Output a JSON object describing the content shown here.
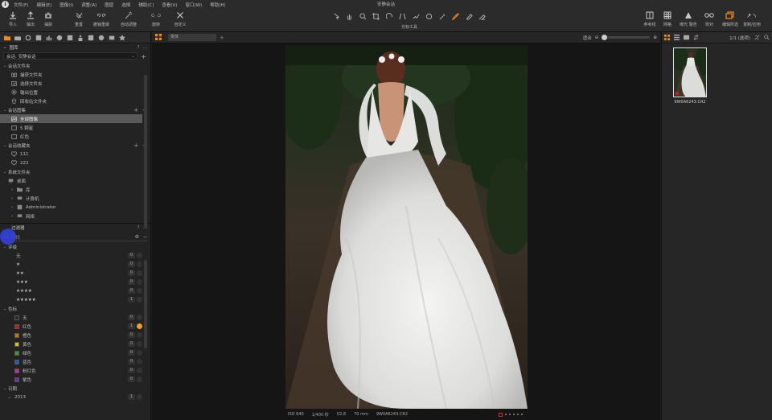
{
  "window": {
    "title": "安静会话",
    "menu": [
      "文件(F)",
      "编辑(E)",
      "图像(I)",
      "调整(A)",
      "图层",
      "选择",
      "辅助(C)",
      "查看(V)",
      "窗口(W)",
      "帮助(H)"
    ]
  },
  "toolbar": {
    "left": [
      {
        "label": "导入",
        "icon": "import-icon"
      },
      {
        "label": "输出",
        "icon": "export-icon"
      },
      {
        "label": "抽获",
        "icon": "camera-icon"
      },
      {
        "label": "重置",
        "icon": "reset-icon"
      },
      {
        "label": "撤销重做",
        "icon": "undo-icon"
      },
      {
        "label": "自动调整",
        "icon": "auto-adjust-icon"
      },
      {
        "label": "旋转",
        "icon": "rotate-icon"
      },
      {
        "label": "自定义",
        "icon": "customize-icon"
      }
    ],
    "cursor_tools_label": "光标工具",
    "right": [
      {
        "label": "参考线",
        "icon": "guides-icon"
      },
      {
        "label": "网格",
        "icon": "grid-icon"
      },
      {
        "label": "曝光 警告",
        "icon": "exposure-warning-icon"
      },
      {
        "label": "校对",
        "icon": "proof-icon"
      },
      {
        "label": "编辑所选",
        "icon": "edit-selected-icon"
      },
      {
        "label": "复制/应用",
        "icon": "copy-apply-icon"
      }
    ]
  },
  "library": {
    "title": "图库",
    "session_select": "会话: 安静会话",
    "session_folders": {
      "title": "会话文件夹",
      "items": [
        "捕获文件夹",
        "选择文件夹",
        "输出位置",
        "回收站文件夹"
      ]
    },
    "session_albums": {
      "title": "会话图集",
      "items": [
        "全部图像",
        "5 颗星",
        "红色"
      ]
    },
    "session_favorites": {
      "title": "会话收藏夹",
      "items": [
        "111",
        "222"
      ]
    },
    "system_folders": {
      "title": "系统文件夹",
      "items": [
        "桌面",
        "库",
        "计算机",
        "Administrator",
        "网络"
      ]
    }
  },
  "filters": {
    "title": "过滤器",
    "search_placeholder": "查找",
    "rating": {
      "title": "评级",
      "rows": [
        {
          "label": "无",
          "count": "0"
        },
        {
          "label": "★",
          "count": "0"
        },
        {
          "label": "★★",
          "count": "0"
        },
        {
          "label": "★★★",
          "count": "0"
        },
        {
          "label": "★★★★",
          "count": "0"
        },
        {
          "label": "★★★★★",
          "count": "1"
        }
      ]
    },
    "color_tag": {
      "title": "色标",
      "rows": [
        {
          "label": "无",
          "count": "0",
          "color": "#2a2a2a"
        },
        {
          "label": "红色",
          "count": "1",
          "color": "#c02020"
        },
        {
          "label": "橙色",
          "count": "0",
          "color": "#d07010"
        },
        {
          "label": "黄色",
          "count": "0",
          "color": "#d0c020"
        },
        {
          "label": "绿色",
          "count": "0",
          "color": "#30a030"
        },
        {
          "label": "蓝色",
          "count": "0",
          "color": "#2060c0"
        },
        {
          "label": "粉红色",
          "count": "0",
          "color": "#c030a0"
        },
        {
          "label": "紫色",
          "count": "0",
          "color": "#7030b0"
        }
      ]
    },
    "date": {
      "title": "日期",
      "rows": [
        {
          "label": "2013",
          "count": "1"
        }
      ]
    }
  },
  "viewer": {
    "variant_tab": "变体",
    "zoom_label": "适合",
    "photo_meta": {
      "iso": "ISO 640",
      "shutter": "1/400 秒",
      "aperture": "f/2.8",
      "focal": "70 mm",
      "filename": "9W0A6243.CR2"
    }
  },
  "browser": {
    "count": "1/1 (选项)",
    "thumb_label": "9W0A6243.CR2"
  },
  "colors": {
    "accent": "#f08a1a",
    "selected_row": "#5a5a5a",
    "cursor": "#3340d8"
  }
}
